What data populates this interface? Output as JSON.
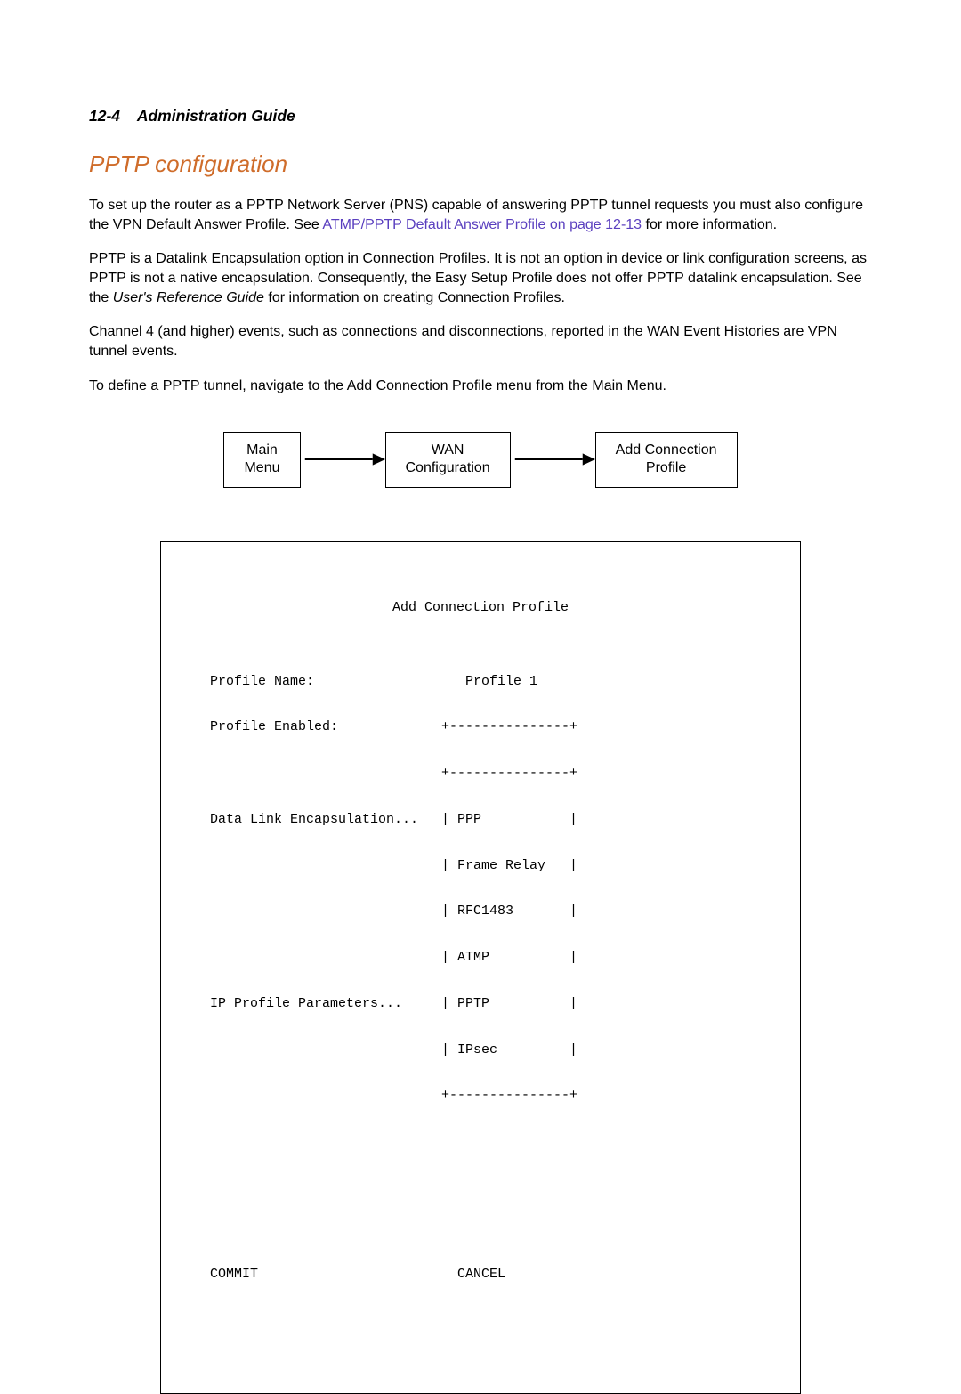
{
  "header": {
    "page_number": "12-4",
    "doc_title": "Administration Guide"
  },
  "section": {
    "title": "PPTP configuration"
  },
  "paragraphs": {
    "p1_a": "To set up the router as a PPTP Network Server (PNS) capable of answering PPTP tunnel requests you must also configure the VPN Default Answer Profile. See ",
    "p1_link": "ATMP/PPTP Default Answer Profile on page 12-13",
    "p1_b": " for more information.",
    "p2_a": "PPTP is a Datalink Encapsulation option in Connection Profiles. It is not an option in device or link configuration screens, as PPTP is not a native encapsulation. Consequently, the Easy Setup Profile does not offer PPTP datalink encapsulation. See the ",
    "p2_italic": "User's Reference Guide",
    "p2_b": " for information on creating Connection Profiles.",
    "p3": "Channel 4 (and higher) events, such as connections and disconnections, reported in the WAN Event Histories are VPN tunnel events.",
    "p4": "To define a PPTP tunnel, navigate to the Add Connection Profile menu from the Main Menu."
  },
  "flow": {
    "box1_line1": "Main",
    "box1_line2": "Menu",
    "box2_line1": "WAN",
    "box2_line2": "Configuration",
    "box3_line1": "Add Connection",
    "box3_line2": "Profile"
  },
  "screen": {
    "title": "Add Connection Profile",
    "profile_name_label": "Profile Name:",
    "profile_name_value": "Profile 1",
    "profile_enabled_label": "Profile Enabled:",
    "dle_label": "Data Link Encapsulation...",
    "ip_params_label": "IP Profile Parameters...",
    "border_top": "+---------------+",
    "border_mid": "+---------------+",
    "border_bot": "+---------------+",
    "opt1": "| PPP           |",
    "opt2": "| Frame Relay   |",
    "opt3": "| RFC1483       |",
    "opt4": "| ATMP          |",
    "opt5": "| PPTP          |",
    "opt6": "| IPsec         |",
    "commit": "COMMIT",
    "cancel": "CANCEL"
  }
}
